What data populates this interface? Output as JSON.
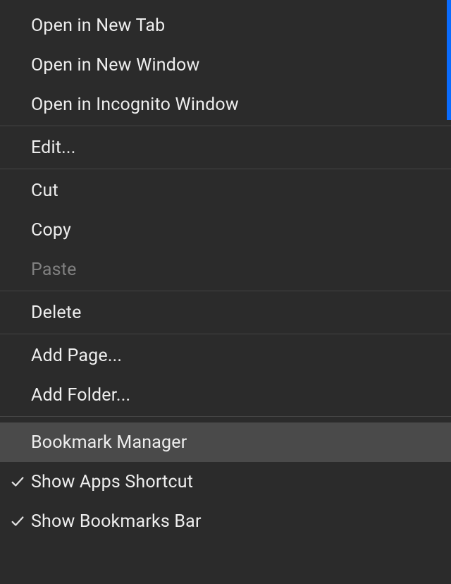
{
  "menu": {
    "open_new_tab": "Open in New Tab",
    "open_new_window": "Open in New Window",
    "open_incognito": "Open in Incognito Window",
    "edit": "Edit...",
    "cut": "Cut",
    "copy": "Copy",
    "paste": "Paste",
    "delete": "Delete",
    "add_page": "Add Page...",
    "add_folder": "Add Folder...",
    "bookmark_manager": "Bookmark Manager",
    "show_apps_shortcut": "Show Apps Shortcut",
    "show_bookmarks_bar": "Show Bookmarks Bar"
  },
  "state": {
    "paste_disabled": true,
    "hovered": "bookmark_manager",
    "show_apps_shortcut_checked": true,
    "show_bookmarks_bar_checked": true
  }
}
